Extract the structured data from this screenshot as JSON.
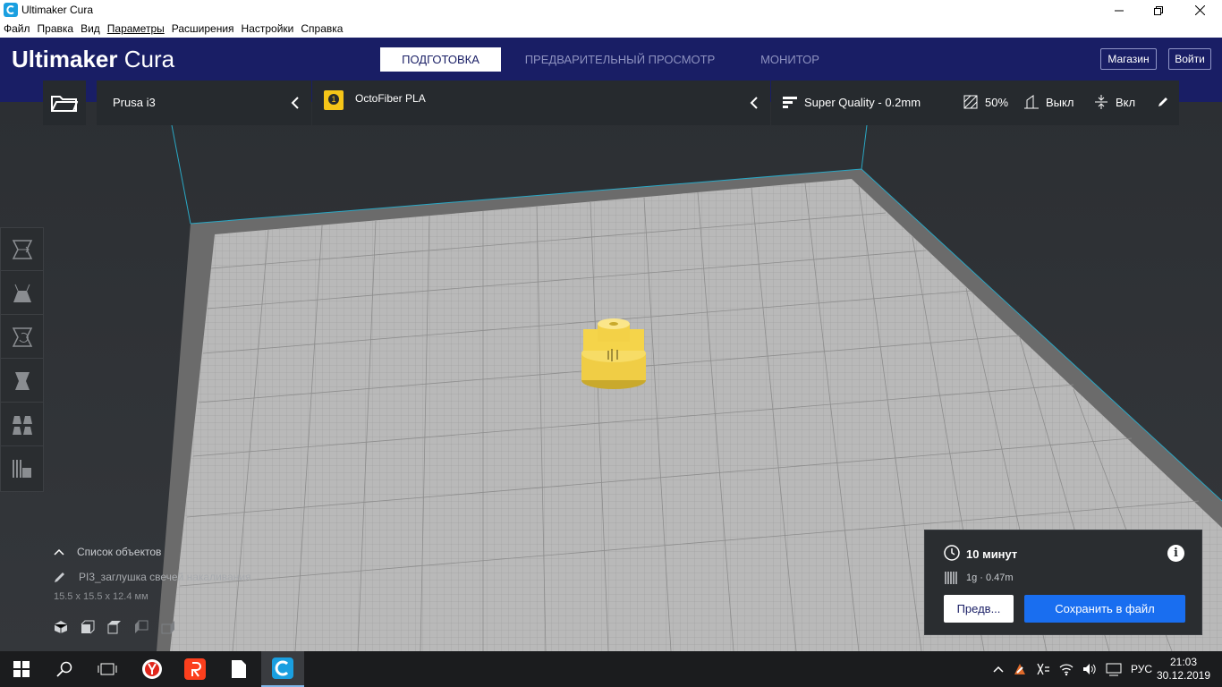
{
  "window": {
    "title": "Ultimaker Cura"
  },
  "menu": [
    "Файл",
    "Правка",
    "Вид",
    "Параметры",
    "Расширения",
    "Настройки",
    "Справка"
  ],
  "header": {
    "logo_bold": "Ultimaker",
    "logo_light": "Cura",
    "tabs": [
      "ПОДГОТОВКА",
      "ПРЕДВАРИТЕЛЬНЫЙ ПРОСМОТР",
      "МОНИТОР"
    ],
    "marketplace": "Магазин",
    "signin": "Войти"
  },
  "strip": {
    "printer": "Prusa i3",
    "extruder_number": "1",
    "material": "OctoFiber PLA",
    "profile": "Super Quality - 0.2mm",
    "infill": "50%",
    "support": "Выкл",
    "adhesion": "Вкл"
  },
  "objects": {
    "header": "Список объектов",
    "name": "PI3_заглушка свечей накаливания",
    "dims": "15.5 x 15.5 x 12.4 мм"
  },
  "print": {
    "time": "10 минут",
    "material_usage": "1g · 0.47m",
    "preview_btn": "Предв...",
    "save_btn": "Сохранить в файл"
  },
  "taskbar": {
    "lang": "РУС",
    "time": "21:03",
    "date": "30.12.2019"
  },
  "colors": {
    "header_bg": "#191e65",
    "save_button": "#196ef0",
    "model_yellow": "#f5d44a"
  }
}
